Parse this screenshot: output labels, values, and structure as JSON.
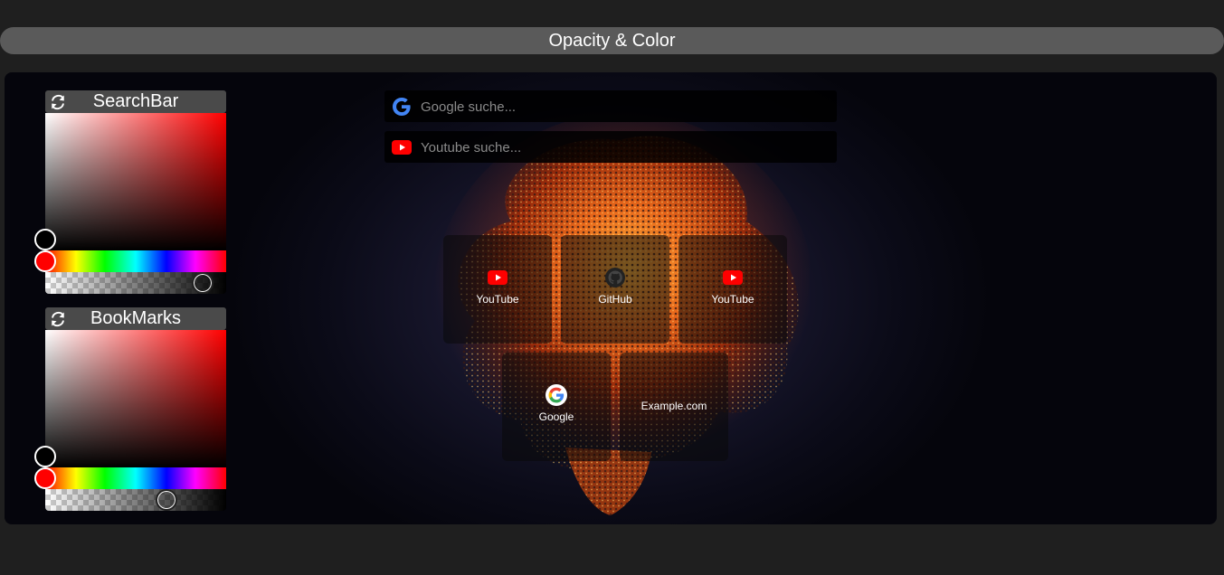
{
  "header": {
    "title": "Opacity & Color"
  },
  "pickers": [
    {
      "label": "SearchBar",
      "hue": 0,
      "saturation": 0,
      "value": 0,
      "alpha": 0.87
    },
    {
      "label": "BookMarks",
      "hue": 0,
      "saturation": 0,
      "value": 0,
      "alpha": 0.67
    }
  ],
  "search": {
    "google": {
      "placeholder": "Google suche...",
      "icon": "google-icon"
    },
    "youtube": {
      "placeholder": "Youtube suche...",
      "icon": "youtube-icon"
    }
  },
  "bookmarks": [
    {
      "label": "YouTube",
      "icon": "youtube-icon"
    },
    {
      "label": "GitHub",
      "icon": "github-icon"
    },
    {
      "label": "YouTube",
      "icon": "youtube-icon"
    },
    {
      "label": "Google",
      "icon": "google-icon"
    },
    {
      "label": "Example.com",
      "icon": ""
    }
  ],
  "colors": {
    "youtube": "#ff0000",
    "google_blue": "#4285f4",
    "panel_head": "#4a4a4a"
  }
}
